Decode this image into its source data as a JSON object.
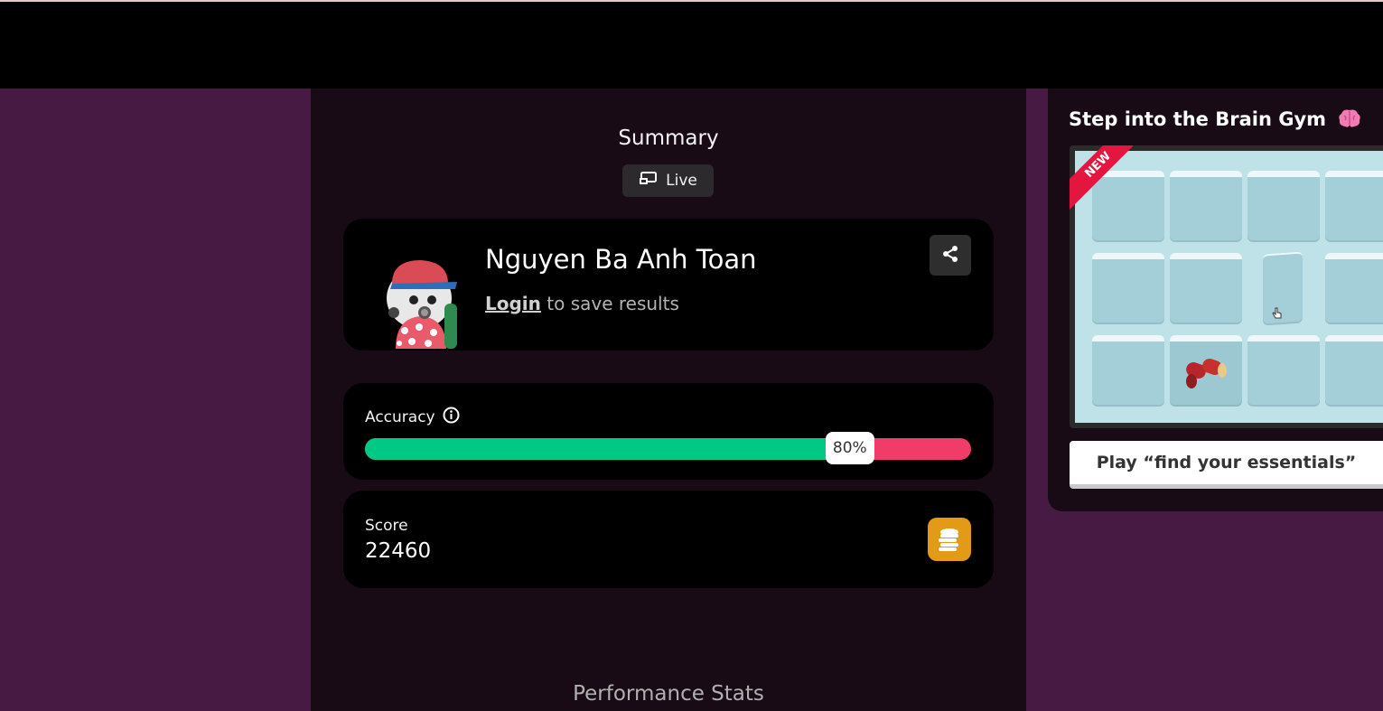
{
  "summary": {
    "title": "Summary",
    "mode_label": "Live",
    "mode_icon": "live-screen-icon"
  },
  "profile": {
    "player_name": "Nguyen Ba Anh Toan",
    "login_link": "Login",
    "login_suffix": " to save results",
    "share_icon": "share-icon",
    "avatar_icon": "avatar-character"
  },
  "accuracy": {
    "label": "Accuracy",
    "info_icon": "info-icon",
    "value": 0.8,
    "value_label": "80%",
    "correct_color": "#00c985",
    "incorrect_color": "#ef3c69"
  },
  "score": {
    "label": "Score",
    "value": "22460",
    "icon": "coins-icon",
    "icon_color": "#e39b17"
  },
  "performance": {
    "title": "Performance Stats"
  },
  "promo": {
    "title": "Step into the Brain Gym",
    "title_icon": "brain-emoji",
    "ribbon": "NEW",
    "button_label": "Play “find your essentials”"
  }
}
